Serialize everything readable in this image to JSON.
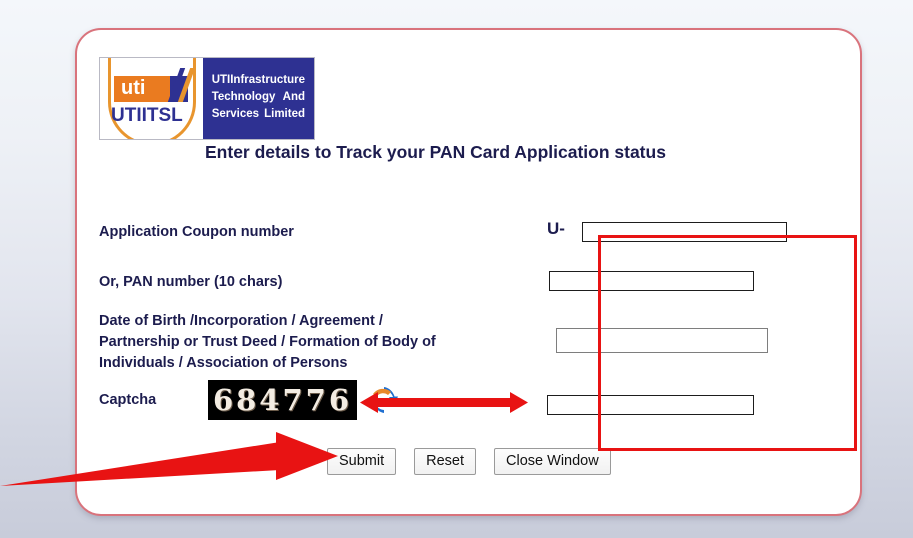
{
  "brand": {
    "mark_text": "uti",
    "mark_subtext": "UTIITSL",
    "name_lines": [
      [
        "UTI",
        "Infrastructure"
      ],
      [
        "Technology",
        "And"
      ],
      [
        "Services",
        "Limited"
      ]
    ],
    "logo_blue": "#2e3192",
    "logo_orange": "#ea7b20"
  },
  "header": {
    "title": "Enter details to Track your PAN Card Application status"
  },
  "form": {
    "labels": {
      "coupon": "Application Coupon number",
      "pan": "Or, PAN number (10 chars)",
      "dob_line1": "Date of Birth /Incorporation / Agreement /",
      "dob_line2": "Partnership or Trust Deed / Formation of Body of",
      "dob_line3": "Individuals / Association of Persons",
      "captcha": "Captcha"
    },
    "coupon_prefix": "U-",
    "fields": {
      "coupon": {
        "value": "",
        "placeholder": ""
      },
      "pan": {
        "value": "",
        "placeholder": ""
      },
      "dob": {
        "value": "",
        "placeholder": ""
      },
      "captcha": {
        "value": "",
        "placeholder": ""
      }
    },
    "captcha_code": "684776",
    "captcha_refresh_icon": "refresh-icon"
  },
  "buttons": {
    "submit": "Submit",
    "reset": "Reset",
    "close": "Close Window"
  },
  "annotations": {
    "highlight_color": "#e81313",
    "box_target": "input-fields-group",
    "arrow_captcha": "captcha-to-input-arrow",
    "arrow_submit": "pointer-to-submit-arrow"
  }
}
